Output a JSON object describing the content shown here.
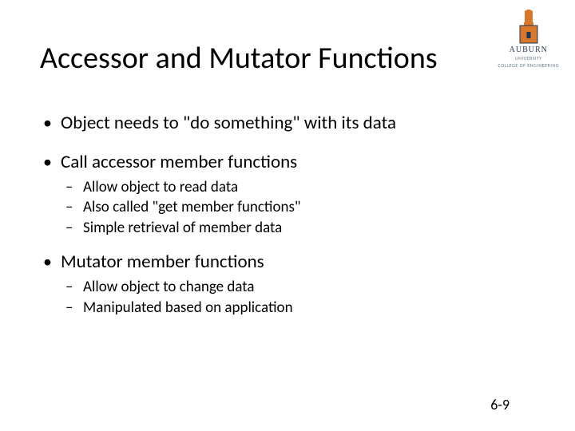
{
  "logo": {
    "word": "AUBURN",
    "sub1": "UNIVERSITY",
    "sub2": "COLLEGE OF ENGINEERING"
  },
  "title": "Accessor and Mutator Functions",
  "bullets": {
    "b1": "Object needs to \"do something\" with its data",
    "b2": "Call accessor member functions",
    "b2_subs": {
      "s1": "Allow object to read data",
      "s2": "Also called \"get member functions\"",
      "s3": "Simple retrieval of member data"
    },
    "b3": "Mutator member functions",
    "b3_subs": {
      "s1": "Allow object to change data",
      "s2": "Manipulated based on application"
    }
  },
  "pagenum": "6-9"
}
